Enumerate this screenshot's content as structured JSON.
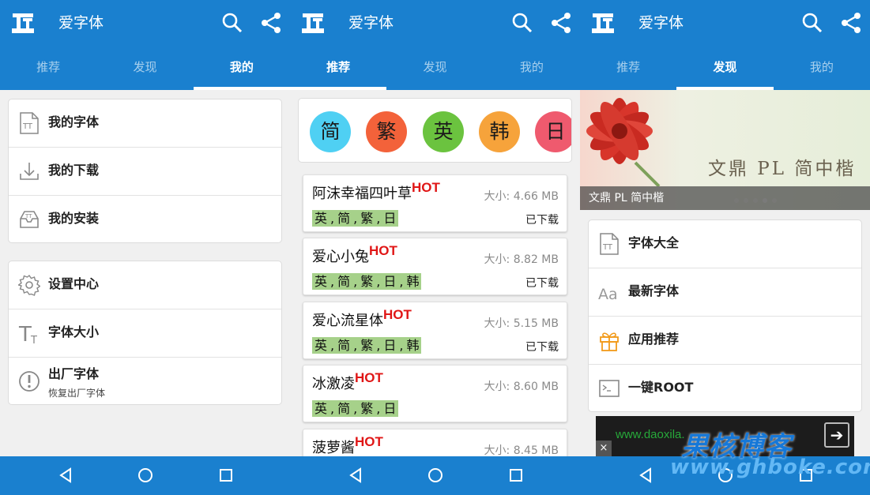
{
  "app": {
    "title": "爱字体"
  },
  "tabs": {
    "recommend": "推荐",
    "discover": "发现",
    "mine": "我的"
  },
  "mine": {
    "group1": [
      {
        "label": "我的字体",
        "icon": "font-file-icon"
      },
      {
        "label": "我的下载",
        "icon": "download-icon"
      },
      {
        "label": "我的安装",
        "icon": "install-tray-icon"
      }
    ],
    "group2": [
      {
        "label": "设置中心",
        "icon": "gear-icon"
      },
      {
        "label": "字体大小",
        "icon": "font-size-icon"
      },
      {
        "label": "出厂字体",
        "sub": "恢复出厂字体",
        "icon": "alert-circle-icon"
      }
    ]
  },
  "recommend": {
    "languages": [
      {
        "label": "简",
        "color": "#4fd0f3"
      },
      {
        "label": "繁",
        "color": "#f3623a"
      },
      {
        "label": "英",
        "color": "#6bc33f"
      },
      {
        "label": "韩",
        "color": "#f6a33b"
      },
      {
        "label": "日",
        "color": "#ef5a6e"
      }
    ],
    "hot_label": "HOT",
    "size_prefix": "大小: ",
    "fonts": [
      {
        "name": "阿沫幸福四叶草",
        "size": "4.66 MB",
        "tags": [
          "英",
          "简",
          "繁",
          "日"
        ],
        "status": "已下载"
      },
      {
        "name": "爱心小兔",
        "size": "8.82 MB",
        "tags": [
          "英",
          "简",
          "繁",
          "日",
          "韩"
        ],
        "status": "已下载"
      },
      {
        "name": "爱心流星体",
        "size": "5.15 MB",
        "tags": [
          "英",
          "简",
          "繁",
          "日",
          "韩"
        ],
        "status": "已下载"
      },
      {
        "name": "冰激凌",
        "size": "8.60 MB",
        "tags": [
          "英",
          "简",
          "繁",
          "日"
        ],
        "status": ""
      },
      {
        "name": "菠萝酱",
        "size": "8.45 MB",
        "tags": [],
        "status": ""
      }
    ]
  },
  "discover": {
    "banner_text": "文鼎 PL 简中楷",
    "banner_caption": "文鼎 PL 简中楷",
    "banner_dots": 5,
    "banner_active_dot": 3,
    "items": [
      {
        "label": "字体大全",
        "icon": "font-file-icon"
      },
      {
        "label": "最新字体",
        "icon": "aa-letters-icon"
      },
      {
        "label": "应用推荐",
        "icon": "gift-icon"
      },
      {
        "label": "一键ROOT",
        "icon": "terminal-icon"
      }
    ],
    "ad": {
      "text": "www.daoxila.",
      "close": "×",
      "arrow": "➔"
    }
  },
  "watermark": {
    "line1": "果核博客",
    "line2": "www.ghboke.com"
  },
  "colors": {
    "primary": "#1a80cf",
    "hot": "#e01616",
    "tag": "#a6d18a"
  }
}
